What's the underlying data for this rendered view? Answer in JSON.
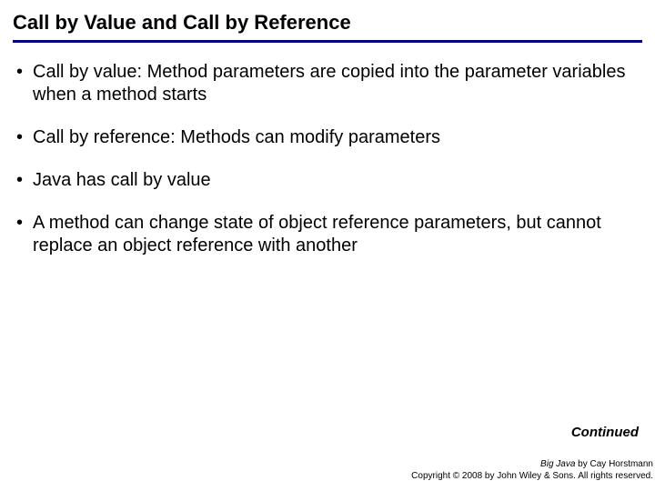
{
  "slide": {
    "title": "Call by Value and Call by Reference",
    "bullets": [
      "Call by value: Method parameters are copied into the parameter variables when a method starts",
      "Call by reference: Methods can modify parameters",
      "Java has call by value",
      "A method can change state of object reference parameters, but cannot replace an object reference with another"
    ],
    "continued": "Continued"
  },
  "footer": {
    "book": "Big Java",
    "author_suffix": " by Cay Horstmann",
    "copyright": "Copyright © 2008 by John Wiley & Sons.  All rights reserved."
  }
}
